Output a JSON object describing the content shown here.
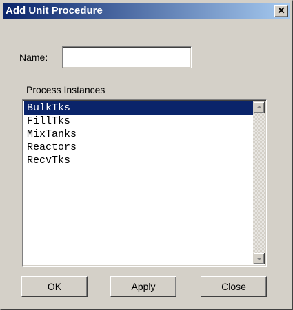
{
  "window": {
    "title": "Add Unit Procedure",
    "close_glyph": "✕"
  },
  "form": {
    "name_label": "Name:",
    "name_value": "",
    "group_label": "Process Instances"
  },
  "list": {
    "items": [
      "BulkTks",
      "FillTks",
      "MixTanks",
      "Reactors",
      "RecvTks"
    ],
    "selected_index": 0
  },
  "buttons": {
    "ok_label": "OK",
    "apply_access_key": "A",
    "apply_rest": "pply",
    "close_label": "Close"
  },
  "colors": {
    "title_bar_start": "#0a246a",
    "title_bar_end": "#a6caf0",
    "face": "#d4d0c8",
    "selection": "#0a246a"
  },
  "icons": {
    "scroll_up": "arrow-up-icon",
    "scroll_down": "arrow-down-icon",
    "close": "close-icon"
  }
}
